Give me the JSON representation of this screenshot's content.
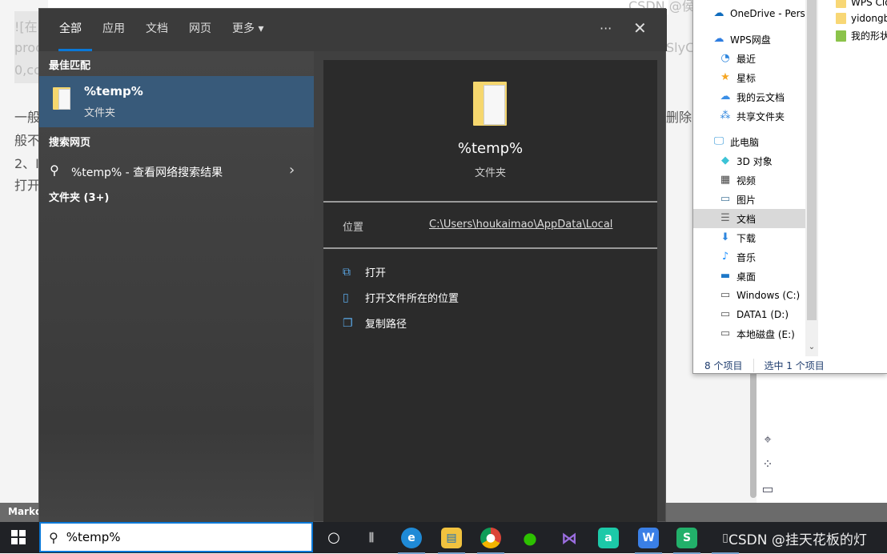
{
  "background": {
    "lines": [
      "![在",
      "proc",
      "0,co",
      "一般",
      "般不",
      "2、I",
      "打开"
    ],
    "right_fragments": [
      "CSDN @侯",
      "SlyC",
      "删除"
    ],
    "bottom_bar_label": "Markd"
  },
  "search_panel": {
    "tabs": [
      {
        "label": "全部",
        "active": true
      },
      {
        "label": "应用"
      },
      {
        "label": "文档"
      },
      {
        "label": "网页"
      },
      {
        "label": "更多 ▾"
      }
    ],
    "more_icon": "ellipsis-icon",
    "close_icon": "close-icon",
    "best_match_heading": "最佳匹配",
    "best_match": {
      "title": "%temp%",
      "subtitle": "文件夹"
    },
    "web_heading": "搜索网页",
    "web_result": "%temp% - 查看网络搜索结果",
    "folders_heading": "文件夹 (3+)",
    "detail": {
      "title": "%temp%",
      "type": "文件夹",
      "location_label": "位置",
      "location_value": "C:\\Users\\houkaimao\\AppData\\Local",
      "actions": [
        {
          "label": "打开",
          "icon": "open-icon"
        },
        {
          "label": "打开文件所在的位置",
          "icon": "file-location-icon"
        },
        {
          "label": "复制路径",
          "icon": "copy-icon"
        }
      ]
    }
  },
  "explorer": {
    "nav": [
      {
        "label": "OneDrive - Pers",
        "icon": "onedrive-icon",
        "level": 1
      },
      {
        "label": "WPS网盘",
        "icon": "wps-cloud-icon",
        "level": 1
      },
      {
        "label": "最近",
        "icon": "clock-icon",
        "level": 2
      },
      {
        "label": "星标",
        "icon": "star-icon",
        "level": 2
      },
      {
        "label": "我的云文档",
        "icon": "cloud-icon",
        "level": 2
      },
      {
        "label": "共享文件夹",
        "icon": "share-icon",
        "level": 2
      },
      {
        "label": "此电脑",
        "icon": "computer-icon",
        "level": 1
      },
      {
        "label": "3D 对象",
        "icon": "cube-icon",
        "level": 2
      },
      {
        "label": "视频",
        "icon": "video-icon",
        "level": 2
      },
      {
        "label": "图片",
        "icon": "picture-icon",
        "level": 2
      },
      {
        "label": "文档",
        "icon": "document-icon",
        "level": 2,
        "selected": true
      },
      {
        "label": "下载",
        "icon": "download-icon",
        "level": 2
      },
      {
        "label": "音乐",
        "icon": "music-icon",
        "level": 2
      },
      {
        "label": "桌面",
        "icon": "desktop-icon",
        "level": 2
      },
      {
        "label": "Windows (C:)",
        "icon": "drive-icon",
        "level": 2
      },
      {
        "label": "DATA1 (D:)",
        "icon": "drive-icon",
        "level": 2
      },
      {
        "label": "本地磁盘 (E:)",
        "icon": "drive-icon",
        "level": 2
      }
    ],
    "files": [
      "WPS Clo",
      "yidongb",
      "我的形状"
    ],
    "status_count": "8 个项目",
    "status_selected": "选中 1 个项目"
  },
  "taskbar": {
    "search_value": "%temp%",
    "apps": [
      "cortana",
      "task-view",
      "edge",
      "file-explorer",
      "chrome",
      "wechat",
      "visual-studio",
      "app-a",
      "wps-writer",
      "wps-sheets",
      "app-doc"
    ],
    "watermark": "CSDN @挂天花板的灯"
  },
  "colors": {
    "accent": "#0a78d7",
    "highlight": "#385a7a",
    "panel": "#404040",
    "detail": "#2b2b2b"
  }
}
